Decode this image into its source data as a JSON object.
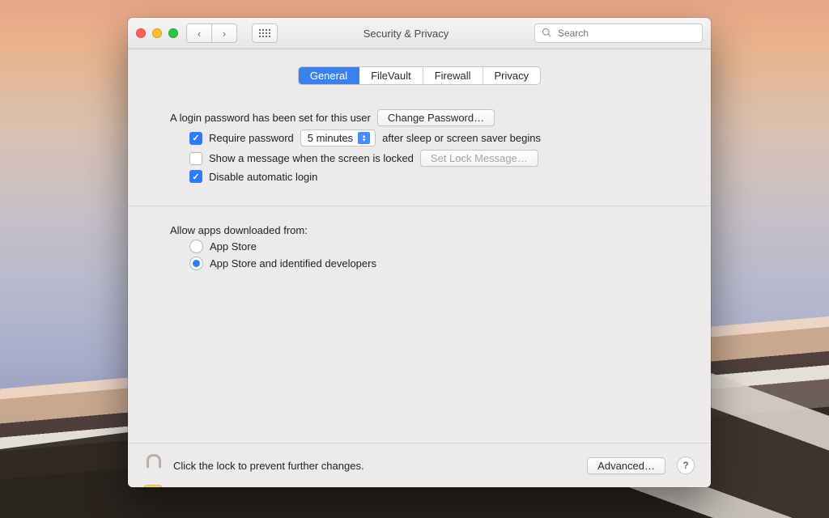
{
  "window": {
    "title": "Security & Privacy"
  },
  "toolbar": {
    "search_placeholder": "Search"
  },
  "tabs": [
    {
      "label": "General",
      "active": true
    },
    {
      "label": "FileVault",
      "active": false
    },
    {
      "label": "Firewall",
      "active": false
    },
    {
      "label": "Privacy",
      "active": false
    }
  ],
  "login": {
    "heading": "A login password has been set for this user",
    "change_btn": "Change Password…",
    "require_pw_checked": true,
    "require_pw_label_before": "Require password",
    "require_pw_delay": "5 minutes",
    "require_pw_label_after": "after sleep or screen saver begins",
    "show_msg_checked": false,
    "show_msg_label": "Show a message when the screen is locked",
    "set_lock_btn": "Set Lock Message…",
    "disable_autologin_checked": true,
    "disable_autologin_label": "Disable automatic login"
  },
  "gatekeeper": {
    "heading": "Allow apps downloaded from:",
    "options": [
      {
        "label": "App Store",
        "selected": false
      },
      {
        "label": "App Store and identified developers",
        "selected": true
      }
    ]
  },
  "footer": {
    "lock_hint": "Click the lock to prevent further changes.",
    "advanced_btn": "Advanced…"
  }
}
